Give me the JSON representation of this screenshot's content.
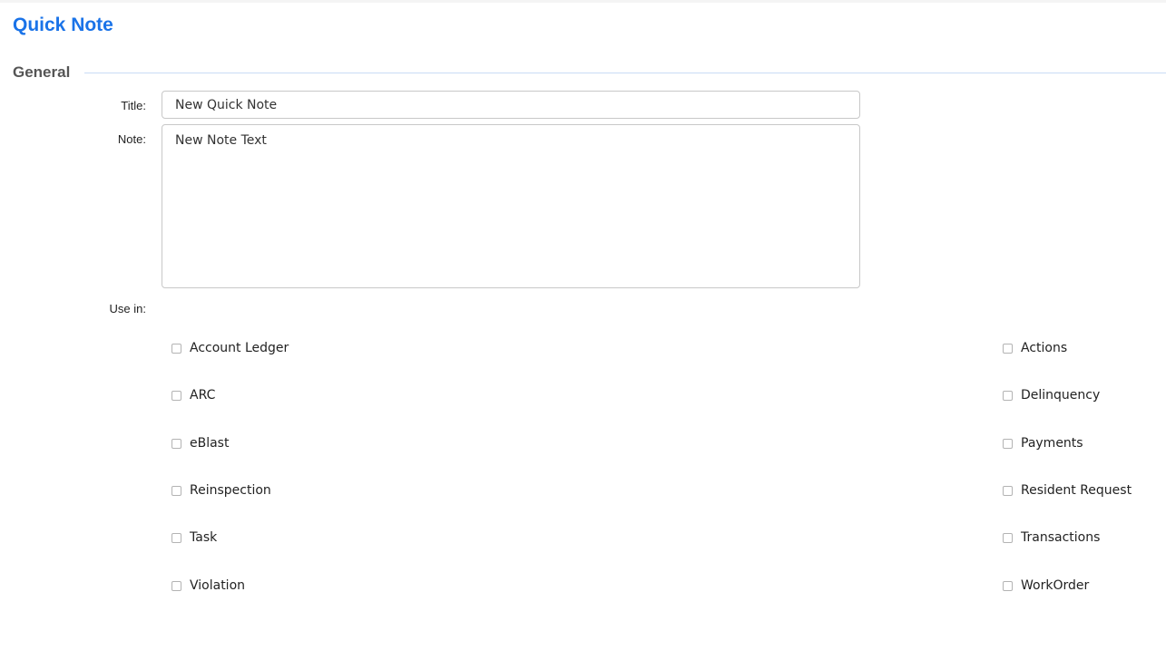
{
  "page": {
    "title": "Quick Note",
    "accent_color": "#1a73e8"
  },
  "general": {
    "section_title": "General",
    "title_label": "Title:",
    "title_value": "New Quick Note",
    "note_label": "Note:",
    "note_value": "New Note Text",
    "use_in_label": "Use in:"
  },
  "use_in": {
    "left": [
      {
        "label": "Account Ledger",
        "checked": false
      },
      {
        "label": "ARC",
        "checked": false
      },
      {
        "label": "eBlast",
        "checked": false
      },
      {
        "label": "Reinspection",
        "checked": false
      },
      {
        "label": "Task",
        "checked": false
      },
      {
        "label": "Violation",
        "checked": false
      }
    ],
    "right": [
      {
        "label": "Actions",
        "checked": false
      },
      {
        "label": "Delinquency",
        "checked": false
      },
      {
        "label": "Payments",
        "checked": false
      },
      {
        "label": "Resident Request",
        "checked": false
      },
      {
        "label": "Transactions",
        "checked": false
      },
      {
        "label": "WorkOrder",
        "checked": false
      }
    ]
  }
}
